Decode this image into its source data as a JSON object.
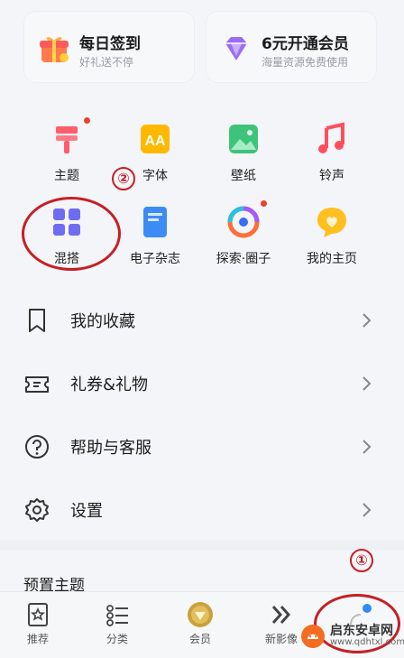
{
  "top_cards": [
    {
      "title": "每日签到",
      "subtitle": "好礼送不停"
    },
    {
      "title": "6元开通会员",
      "subtitle": "海量资源免费使用"
    }
  ],
  "grid": [
    {
      "label": "主题"
    },
    {
      "label": "字体"
    },
    {
      "label": "壁纸"
    },
    {
      "label": "铃声"
    },
    {
      "label": "混搭"
    },
    {
      "label": "电子杂志"
    },
    {
      "label": "探索·圈子"
    },
    {
      "label": "我的主页"
    }
  ],
  "menu": [
    {
      "label": "我的收藏"
    },
    {
      "label": "礼券&礼物"
    },
    {
      "label": "帮助与客服"
    },
    {
      "label": "设置"
    }
  ],
  "section_title": "预置主题",
  "tabs": [
    {
      "label": "推荐"
    },
    {
      "label": "分类"
    },
    {
      "label": "会员"
    },
    {
      "label": "新影像"
    },
    {
      "label": ""
    }
  ],
  "annotations": {
    "one": "①",
    "two": "②"
  },
  "watermark": {
    "name": "启东安卓网",
    "url": "www.qdhtxl.com"
  },
  "colors": {
    "annotation_red": "#c61f24",
    "badge_red": "#e8412c"
  }
}
